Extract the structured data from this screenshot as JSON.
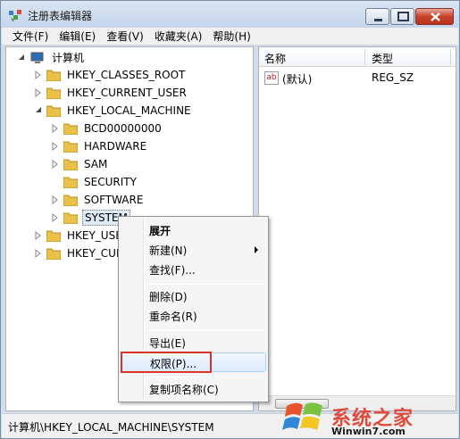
{
  "window": {
    "title": "注册表编辑器"
  },
  "menubar": {
    "items": [
      "文件(F)",
      "编辑(E)",
      "查看(V)",
      "收藏夹(A)",
      "帮助(H)"
    ]
  },
  "tree": {
    "root": "计算机",
    "hives": {
      "classes_root": "HKEY_CLASSES_ROOT",
      "current_user": "HKEY_CURRENT_USER",
      "local_machine": "HKEY_LOCAL_MACHINE",
      "users": "HKEY_USE",
      "current_config": "HKEY_CUR"
    },
    "local_machine_children": [
      "BCD00000000",
      "HARDWARE",
      "SAM",
      "SECURITY",
      "SOFTWARE",
      "SYSTEM"
    ],
    "selected": "SYSTEM"
  },
  "list": {
    "columns": {
      "name": "名称",
      "type": "类型"
    },
    "rows": [
      {
        "icon": "ab",
        "name": "(默认)",
        "type": "REG_SZ"
      }
    ]
  },
  "context_menu": {
    "expand": "展开",
    "new": "新建(N)",
    "find": "查找(F)...",
    "delete": "删除(D)",
    "rename": "重命名(R)",
    "export": "导出(E)",
    "permissions": "权限(P)...",
    "copy_key_name": "复制项名称(C)"
  },
  "statusbar": {
    "path": "计算机\\HKEY_LOCAL_MACHINE\\SYSTEM"
  },
  "watermark": {
    "text": "系统之家",
    "url": "Winwin7.com",
    "logo_text": "Win7"
  },
  "colors": {
    "highlight_border": "#d9322b",
    "folder": "#e8c04a",
    "title_bar": "#c4d5ea"
  }
}
